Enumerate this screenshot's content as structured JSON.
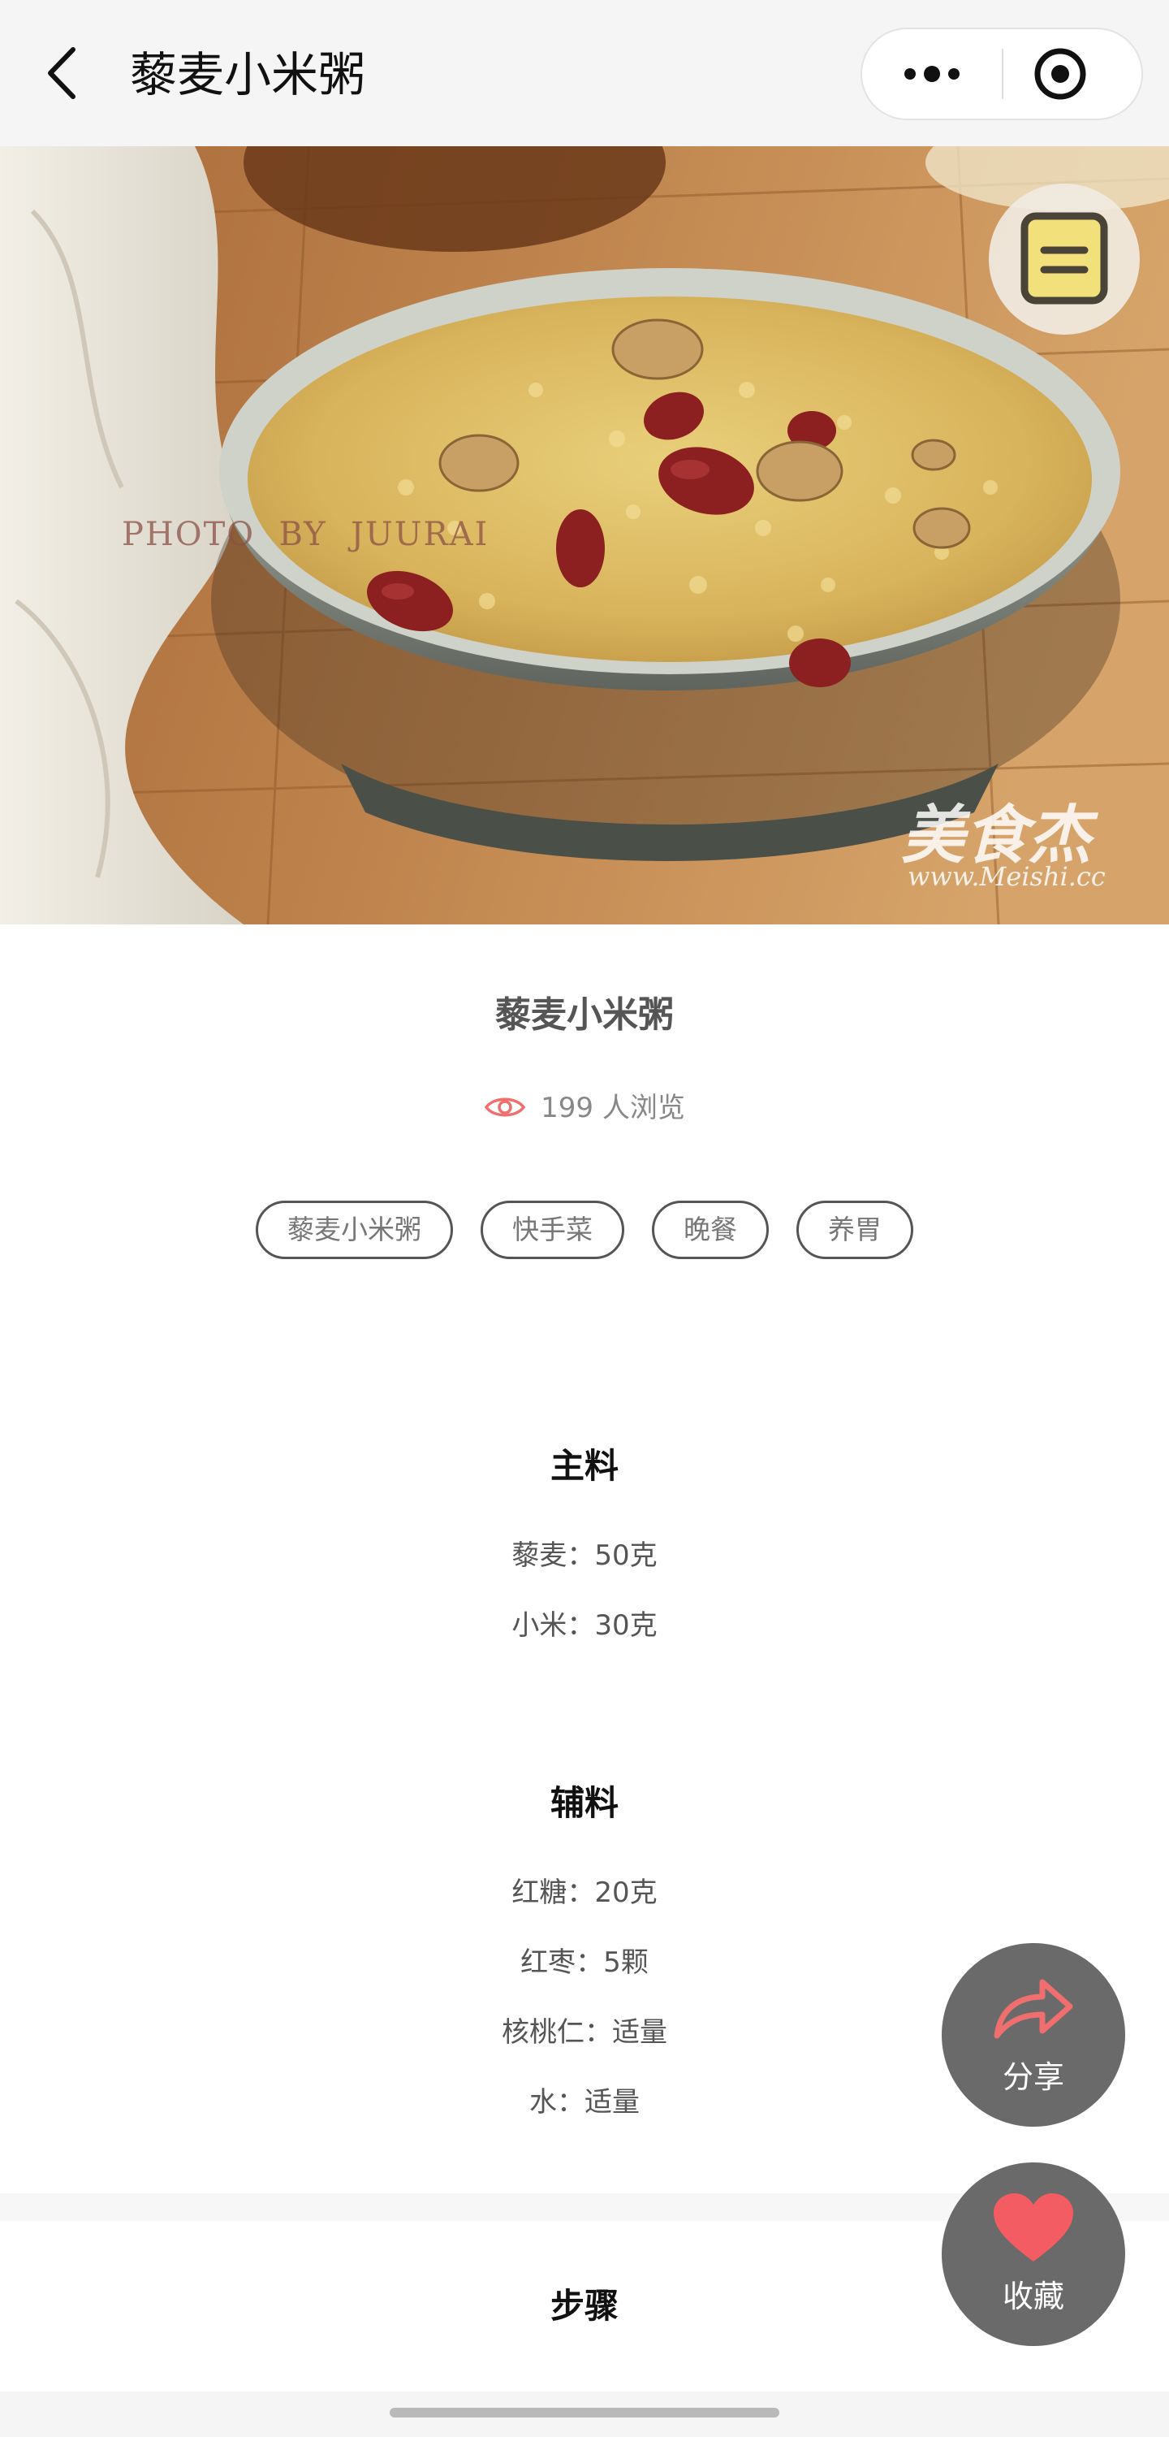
{
  "nav": {
    "title": "藜麦小米粥"
  },
  "hero": {
    "photo_credit": "PHOTO  BY  JUURAI",
    "watermark_brand": "美食杰",
    "watermark_url": "www.Meishi.cc"
  },
  "recipe": {
    "title": "藜麦小米粥",
    "views": "199 人浏览",
    "tags": [
      "藜麦小米粥",
      "快手菜",
      "晚餐",
      "养胃"
    ]
  },
  "main_ingredients": {
    "heading": "主料",
    "items": [
      "藜麦：50克",
      "小米：30克"
    ]
  },
  "aux_ingredients": {
    "heading": "辅料",
    "items": [
      "红糖：20克",
      "红枣：5颗",
      "核桃仁：适量",
      "水：适量"
    ]
  },
  "steps": {
    "heading": "步骤"
  },
  "actions": {
    "share_label": "分享",
    "favorite_label": "收藏"
  },
  "colors": {
    "accent": "#f06e6e",
    "fab_bg": "#5f5f5f",
    "topbar_bg": "#f5f5f5"
  },
  "icons": {
    "back": "chevron-left-icon",
    "more": "more-dots-icon",
    "close": "target-circle-icon",
    "notes": "notes-icon",
    "views": "eye-icon",
    "share": "share-arrow-icon",
    "favorite": "heart-icon"
  }
}
